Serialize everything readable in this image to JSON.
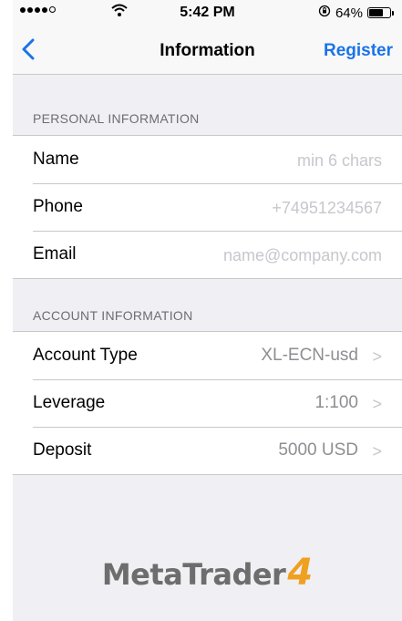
{
  "status_bar": {
    "time": "5:42 PM",
    "battery_percent": "64%",
    "battery_level": 0.64,
    "signal_bars": 4,
    "icons": [
      "signal-icon",
      "wifi-icon",
      "orientation-lock-icon",
      "battery-icon"
    ]
  },
  "nav": {
    "back_icon": "chevron-left-icon",
    "title": "Information",
    "register_label": "Register",
    "accent_color": "#1a73e8"
  },
  "personal": {
    "header": "PERSONAL INFORMATION",
    "name_label": "Name",
    "name_placeholder": "min 6 chars",
    "phone_label": "Phone",
    "phone_placeholder": "+74951234567",
    "email_label": "Email",
    "email_placeholder": "name@company.com"
  },
  "account": {
    "header": "ACCOUNT INFORMATION",
    "type_label": "Account Type",
    "type_value": "XL-ECN-usd",
    "leverage_label": "Leverage",
    "leverage_value": "1:100",
    "deposit_label": "Deposit",
    "deposit_value": "5000 USD"
  },
  "logo": {
    "text": "MetaTrader",
    "number": "4"
  }
}
